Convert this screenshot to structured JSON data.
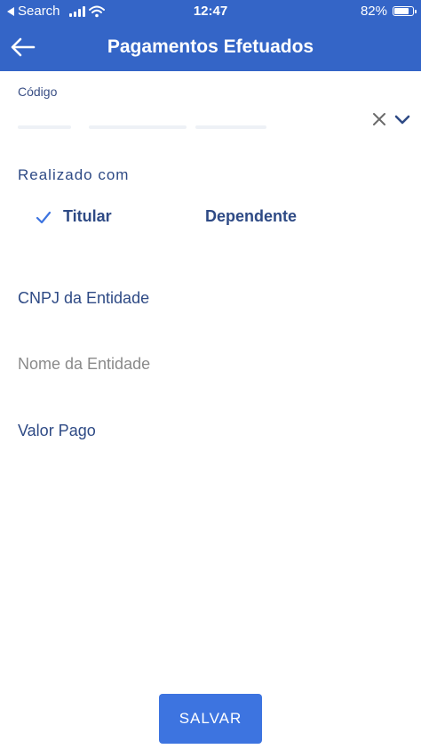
{
  "status_bar": {
    "back_label": "Search",
    "time": "12:47",
    "battery": "82%",
    "battery_level": 0.82
  },
  "header": {
    "title": "Pagamentos Efetuados",
    "back_icon": "arrow-left-icon"
  },
  "form": {
    "codigo": {
      "label": "Código",
      "value": "",
      "icons": [
        "close-icon",
        "chevron-down-icon"
      ]
    },
    "realizado_com": {
      "label": "Realizado com",
      "options": [
        {
          "label": "Titular",
          "selected": true
        },
        {
          "label": "Dependente",
          "selected": false
        }
      ]
    },
    "cnpj": {
      "placeholder": "CNPJ da Entidade",
      "disabled": false
    },
    "nome": {
      "placeholder": "Nome da Entidade",
      "disabled": true
    },
    "valor": {
      "placeholder": "Valor Pago",
      "disabled": false
    }
  },
  "actions": {
    "save_label": "SALVAR"
  },
  "colors": {
    "header_bg": "#3465c7",
    "primary_text": "#2e4a85",
    "button_bg": "#3d74e0",
    "disabled_text": "#8a8a8a"
  }
}
